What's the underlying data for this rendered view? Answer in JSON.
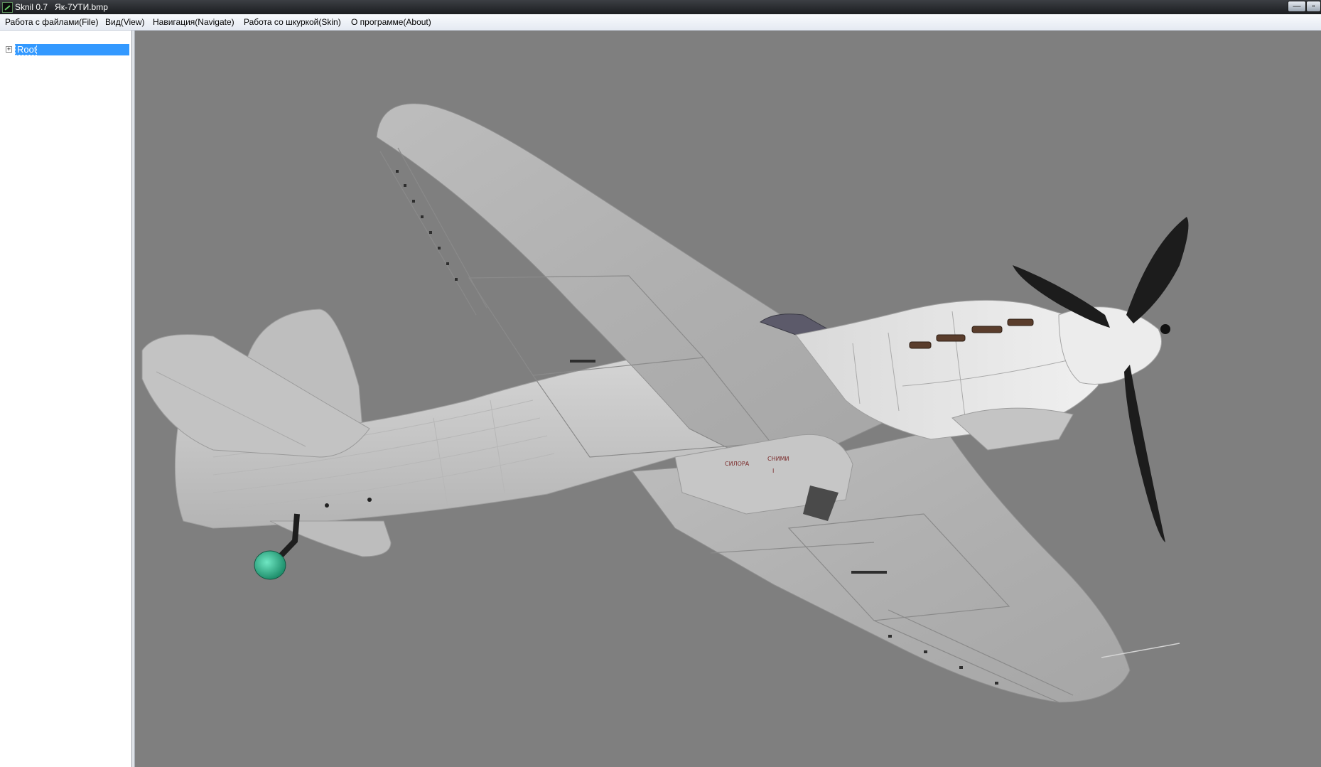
{
  "window": {
    "app_name": "Sknil 0.7",
    "file_name": "Як-7УТИ.bmp",
    "minimize_glyph": "—",
    "close_glyph": "▫"
  },
  "menu": {
    "items": [
      "Работа с файлами(File)",
      "Вид(View)",
      "Навигация(Navigate)",
      "Работа со шкуркой(Skin)",
      "О программе(About)"
    ]
  },
  "tree": {
    "expander_glyph": "+",
    "root_label": "Root"
  },
  "model": {
    "markings": [
      "СИЛОРА",
      "СНИМИ"
    ],
    "marking_sub": "I"
  },
  "colors": {
    "viewport_bg": "#7f7f7f",
    "fuselage": "#c9c9c9",
    "propeller": "#1c1c1c",
    "wheel": "#2fb389",
    "selection": "#3399ff"
  }
}
